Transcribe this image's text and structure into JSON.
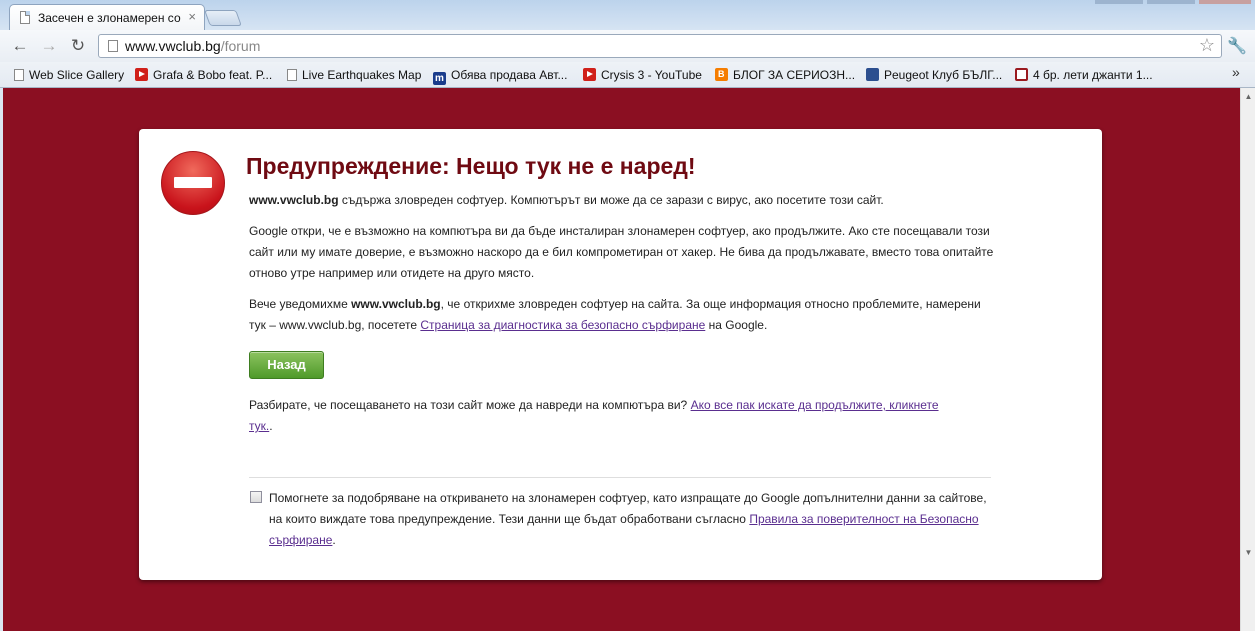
{
  "tab": {
    "title": "Засечен е злонамерен со",
    "close": "×"
  },
  "toolbar": {
    "back": "←",
    "forward": "→",
    "reload": "↻",
    "url_domain": "www.vwclub.bg",
    "url_path": "/forum",
    "star": "☆",
    "wrench": "🔧"
  },
  "bookmarks": {
    "items": [
      {
        "label": "Web Slice Gallery"
      },
      {
        "label": "Grafa & Bobo feat. P..."
      },
      {
        "label": "Live Earthquakes Map"
      },
      {
        "label": "Обява продава Авт..."
      },
      {
        "label": "Crysis 3 - YouTube"
      },
      {
        "label": "БЛОГ ЗА СЕРИОЗН..."
      },
      {
        "label": "Peugeot Клуб БЪЛГ..."
      },
      {
        "label": "4 бр. лети джанти 1..."
      }
    ],
    "more": "»",
    "m_icon": "m"
  },
  "warning": {
    "headline": "Предупреждение: Нещо тук не е наред!",
    "p1_site": "www.vwclub.bg",
    "p1_text": " съдържа зловреден софтуер. Компютърът ви може да се зарази с вирус, ако посетите този сайт.",
    "p2": "Google откри, че е възможно на компютъра ви да бъде инсталиран злонамерен софтуер, ако продължите. Ако сте посещавали този сайт или му имате доверие, е възможно наскоро да е бил компрометиран от хакер. Не бива да продължавате, вместо това опитайте отново утре например или отидете на друго място.",
    "p3_pre": "Вече уведомихме ",
    "p3_site": "www.vwclub.bg",
    "p3_mid": ", че открихме зловреден софтуер на сайта. За още информация относно проблемите, намерени тук – www.vwclub.bg, посетете ",
    "p3_link": "Страница за диагностика за безопасно сърфиране",
    "p3_post": " на Google.",
    "back_button": "Назад",
    "p4_pre": "Разбирате, че посещаването на този сайт може да навреди на компютъра ви? ",
    "p4_link": "Ако все пак искате да продължите, кликнете тук.",
    "p4_post": ".",
    "report_text": "Помогнете за подобряване на откриването на злонамерен софтуер, като изпращате до Google допълнителни данни за сайтове, на които виждате това предупреждение. Тези данни ще бъдат обработвани съгласно ",
    "report_link": "Правила за поверителност на Безопасно сърфиране",
    "report_post": "."
  },
  "colors": {
    "page_background": "#8b0f22",
    "headline": "#6f0a12",
    "button_green": "#4f9a2a",
    "link": "#5a2e8f"
  }
}
